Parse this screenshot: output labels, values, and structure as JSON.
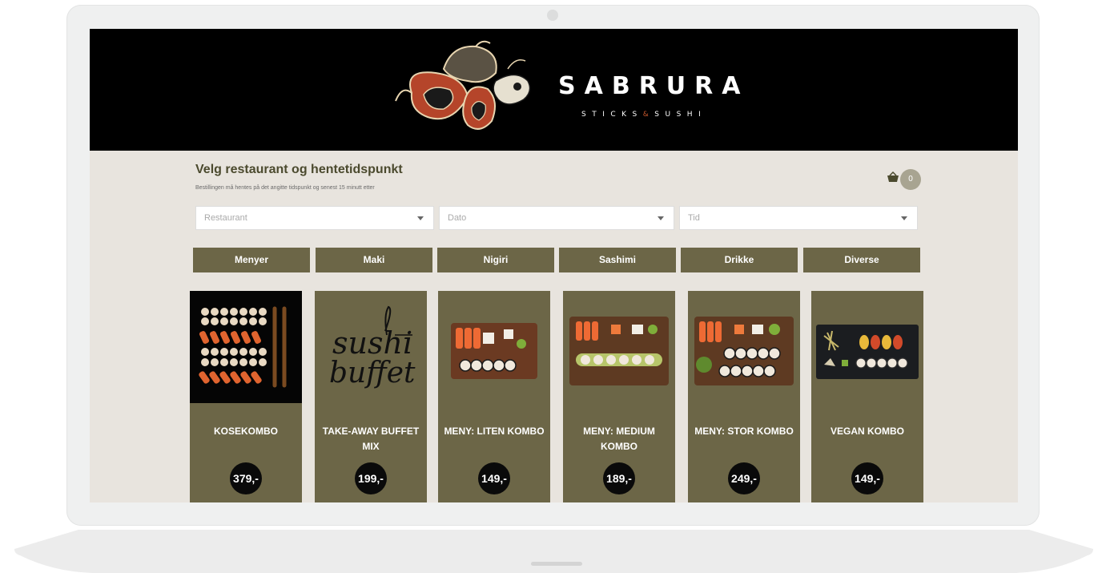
{
  "brand": {
    "name": "SABRURA",
    "tagline_left": "STICKS",
    "tagline_amp": "&",
    "tagline_right": "SUSHI"
  },
  "selection": {
    "title": "Velg restaurant og hentetidspunkt",
    "subtitle": "Bestillingen må hentes på det angitte tidspunkt og senest 15 minutt etter",
    "restaurant_placeholder": "Restaurant",
    "date_placeholder": "Dato",
    "time_placeholder": "Tid"
  },
  "cart": {
    "count": "0"
  },
  "tabs": [
    {
      "label": "Menyer"
    },
    {
      "label": "Maki"
    },
    {
      "label": "Nigiri"
    },
    {
      "label": "Sashimi"
    },
    {
      "label": "Drikke"
    },
    {
      "label": "Diverse"
    }
  ],
  "products": [
    {
      "name": "KOSEKOMBO",
      "price": "379,-"
    },
    {
      "name": "TAKE-AWAY BUFFET MIX",
      "price": "199,-"
    },
    {
      "name": "MENY: LITEN KOMBO",
      "price": "149,-"
    },
    {
      "name": "MENY: MEDIUM KOMBO",
      "price": "189,-"
    },
    {
      "name": "MENY: STOR KOMBO",
      "price": "249,-"
    },
    {
      "name": "VEGAN KOMBO",
      "price": "149,-"
    }
  ],
  "buffet_logo": {
    "line1": "sushi",
    "line2": "buffet"
  },
  "colors": {
    "accent": "#6c6647",
    "background": "#e8e4de",
    "header": "#000000",
    "brand_amp": "#c3562c"
  }
}
